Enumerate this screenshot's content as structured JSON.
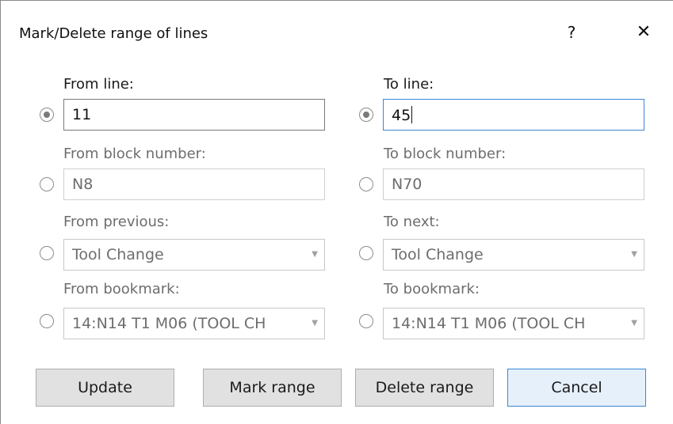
{
  "dialog": {
    "title": "Mark/Delete range of lines",
    "help_label": "?",
    "close_label": "✕"
  },
  "from": {
    "line_label": "From line:",
    "line_value": "11",
    "block_label": "From block number:",
    "block_value": "N8",
    "previous_label": "From previous:",
    "previous_value": "Tool Change",
    "bookmark_label": "From bookmark:",
    "bookmark_value": "14:N14 T1 M06 (TOOL CH"
  },
  "to": {
    "line_label": "To line:",
    "line_value": "45",
    "block_label": "To block number:",
    "block_value": "N70",
    "next_label": "To next:",
    "next_value": "Tool Change",
    "bookmark_label": "To bookmark:",
    "bookmark_value": "14:N14 T1 M06 (TOOL CH"
  },
  "buttons": {
    "update": "Update",
    "mark_range": "Mark range",
    "delete_range": "Delete range",
    "cancel": "Cancel"
  },
  "icons": {
    "combo_arrow": "chevron-down-icon"
  }
}
